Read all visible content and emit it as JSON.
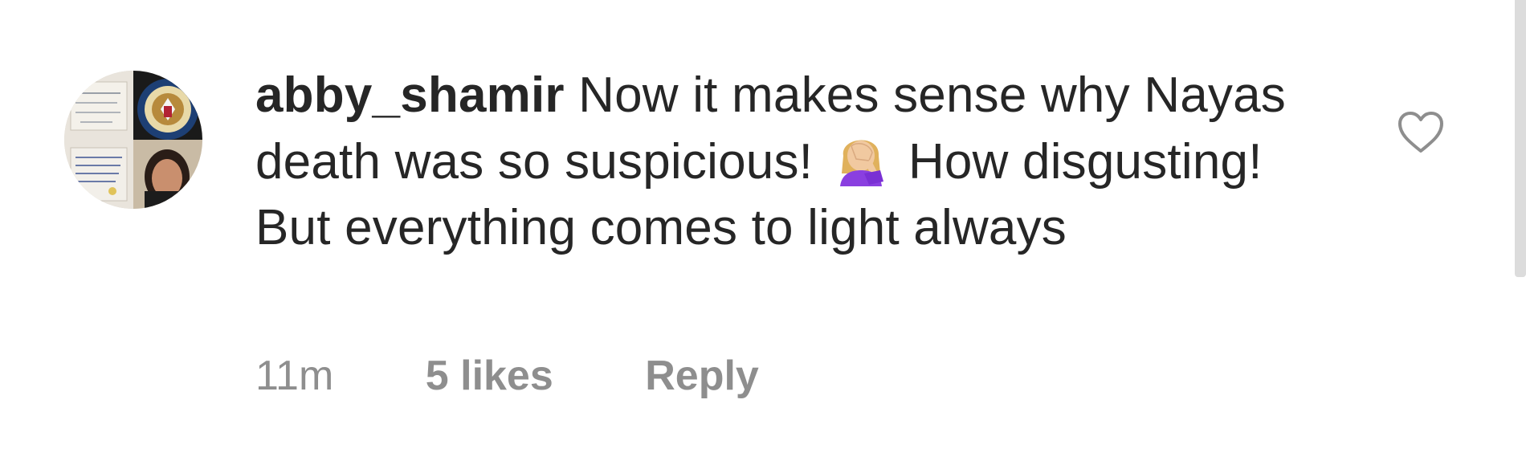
{
  "comment": {
    "username": "abby_shamir",
    "text_part1": "Now it makes sense why Nayas death was so suspicious!",
    "emoji": "face-palm-emoji",
    "text_part2": "How disgusting! But everything comes to light always",
    "time": "11m",
    "likes": "5 likes",
    "reply_label": "Reply"
  },
  "icons": {
    "like": "heart-outline-icon",
    "reaction": "woman-facepalming-emoji"
  },
  "colors": {
    "text": "#262626",
    "muted": "#8e8e8e",
    "heart_stroke": "#8e8e8e",
    "background": "#ffffff"
  }
}
